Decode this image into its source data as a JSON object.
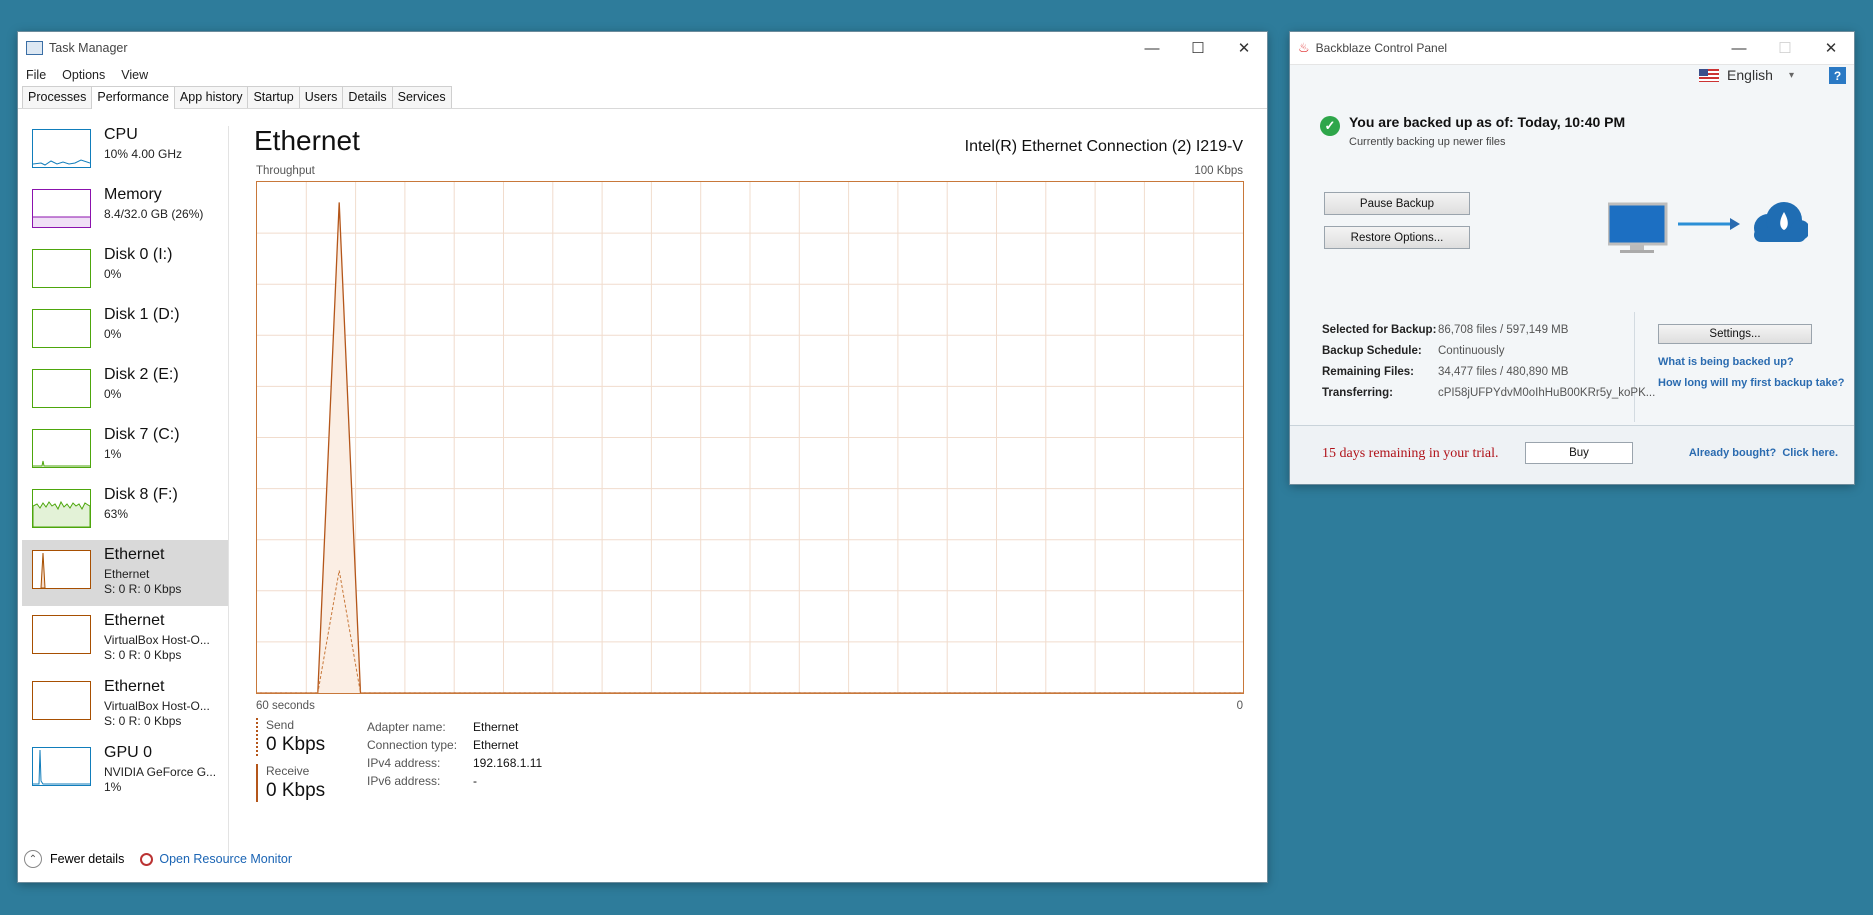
{
  "task_manager": {
    "title": "Task Manager",
    "menu": [
      "File",
      "Options",
      "View"
    ],
    "tabs": [
      "Processes",
      "Performance",
      "App history",
      "Startup",
      "Users",
      "Details",
      "Services"
    ],
    "active_tab": "Performance",
    "sidebar": [
      {
        "title": "CPU",
        "sub": "10% 4.00 GHz",
        "sub2": "",
        "color": "#117dbb",
        "level": 0.1
      },
      {
        "title": "Memory",
        "sub": "8.4/32.0 GB (26%)",
        "sub2": "",
        "color": "#8b12ae",
        "level": 0.26
      },
      {
        "title": "Disk 0 (I:)",
        "sub": "0%",
        "sub2": "",
        "color": "#4da60c",
        "level": 0
      },
      {
        "title": "Disk 1 (D:)",
        "sub": "0%",
        "sub2": "",
        "color": "#4da60c",
        "level": 0
      },
      {
        "title": "Disk 2 (E:)",
        "sub": "0%",
        "sub2": "",
        "color": "#4da60c",
        "level": 0
      },
      {
        "title": "Disk 7 (C:)",
        "sub": "1%",
        "sub2": "",
        "color": "#4da60c",
        "level": 0.01
      },
      {
        "title": "Disk 8 (F:)",
        "sub": "63%",
        "sub2": "",
        "color": "#4da60c",
        "level": 0.63
      },
      {
        "title": "Ethernet",
        "sub": "Ethernet",
        "sub2": "S: 0 R: 0 Kbps",
        "color": "#a74f01",
        "level": 0,
        "selected": true
      },
      {
        "title": "Ethernet",
        "sub": "VirtualBox Host-O...",
        "sub2": "S: 0 R: 0 Kbps",
        "color": "#a74f01",
        "level": 0
      },
      {
        "title": "Ethernet",
        "sub": "VirtualBox Host-O...",
        "sub2": "S: 0 R: 0 Kbps",
        "color": "#a74f01",
        "level": 0
      },
      {
        "title": "GPU 0",
        "sub": "NVIDIA GeForce G...",
        "sub2": "1%",
        "color": "#117dbb",
        "level": 0.01
      }
    ],
    "main": {
      "title": "Ethernet",
      "adapter": "Intel(R) Ethernet Connection (2) I219-V",
      "graph_label": "Throughput",
      "graph_max": "100 Kbps",
      "graph_xleft": "60 seconds",
      "graph_xright": "0",
      "send_label": "Send",
      "send_value": "0 Kbps",
      "receive_label": "Receive",
      "receive_value": "0 Kbps",
      "properties": [
        {
          "k": "Adapter name:",
          "v": "Ethernet"
        },
        {
          "k": "Connection type:",
          "v": "Ethernet"
        },
        {
          "k": "IPv4 address:",
          "v": "192.168.1.11"
        },
        {
          "k": "IPv6 address:",
          "v": "-"
        }
      ]
    },
    "footer": {
      "fewer_details": "Fewer details",
      "resource_monitor": "Open Resource Monitor"
    }
  },
  "backblaze": {
    "title": "Backblaze Control Panel",
    "language": "English",
    "status_headline": "You are backed up as of: Today, 10:40 PM",
    "status_sub": "Currently backing up newer files",
    "pause_button": "Pause Backup",
    "restore_button": "Restore Options...",
    "settings_button": "Settings...",
    "details": [
      {
        "k": "Selected for Backup:",
        "v": "86,708 files / 597,149 MB"
      },
      {
        "k": "Backup Schedule:",
        "v": "Continuously"
      },
      {
        "k": "Remaining Files:",
        "v": "34,477 files / 480,890 MB"
      },
      {
        "k": "Transferring:",
        "v": "cPI58jUFPYdvM0oIhHuB00KRr5y_koPK..."
      }
    ],
    "links": [
      "What is being backed up?",
      "How long will my first backup take?"
    ],
    "trial_text": "15 days remaining in your trial.",
    "buy_button": "Buy",
    "already_bought": "Already bought?  Click here."
  },
  "chart_data": {
    "type": "line",
    "title": "",
    "xlabel": "",
    "ylabel": "Throughput",
    "x_range": [
      60,
      0
    ],
    "y_range": [
      0,
      100
    ],
    "series": [
      {
        "x": [
          60,
          57,
          56.3,
          55,
          53.7,
          53,
          0
        ],
        "values": [
          0,
          0,
          0,
          96,
          0,
          0,
          0
        ]
      },
      {
        "x": [
          60,
          57,
          56.3,
          55,
          53.7,
          53,
          0
        ],
        "values": [
          0,
          0,
          0,
          24,
          0,
          0,
          0
        ]
      }
    ],
    "grid": true
  }
}
